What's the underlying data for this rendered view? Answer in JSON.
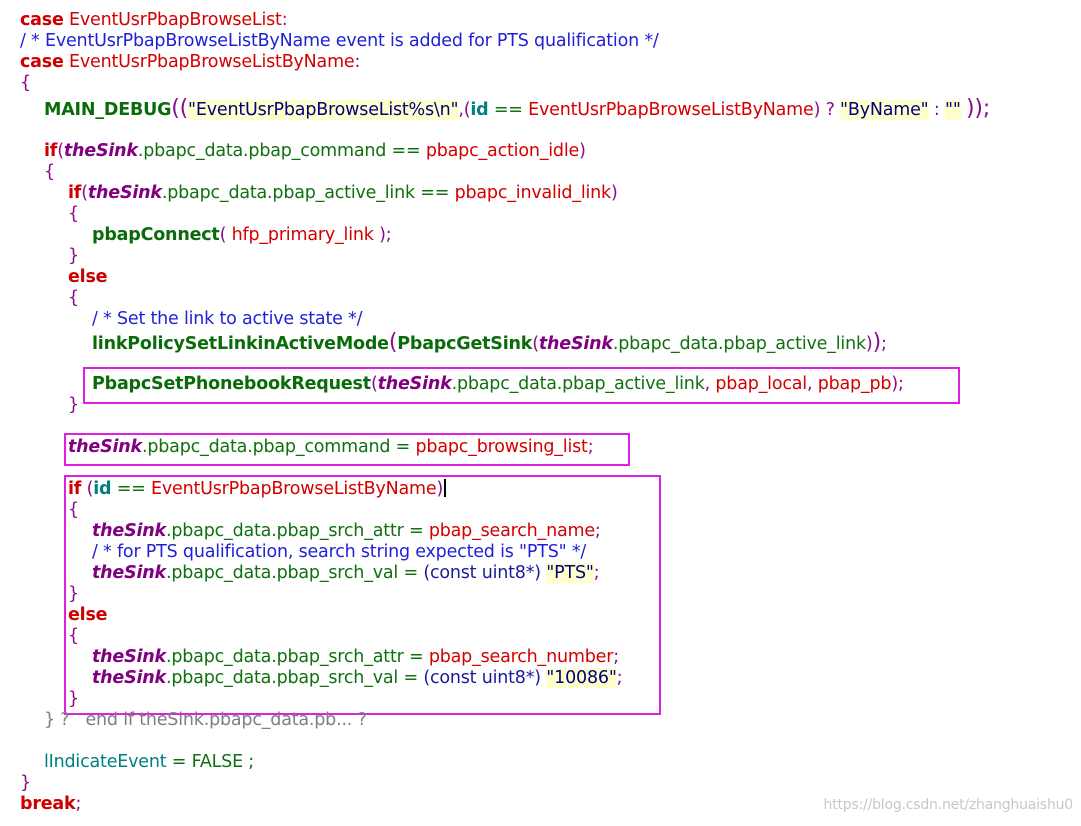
{
  "code": {
    "case1_kw": "case",
    "case1_ev": "EventUsrPbapBrowseList",
    "colon": ":",
    "comment_pts": "/ * EventUsrPbapBrowseListByName event is added for PTS qualification */",
    "case2_kw": "case",
    "case2_ev": "EventUsrPbapBrowseListByName",
    "brace_open": "{",
    "brace_close": "}",
    "main_debug": "MAIN_DEBUG",
    "paren_open_double": "((",
    "paren_close_double": "));",
    "debug_fmt": "\"EventUsrPbapBrowseList%s\\n\"",
    "comma_paren": ",(",
    "id_kw": "id",
    "eqeq": " == ",
    "byname_ev": "EventUsrPbapBrowseListByName",
    "ternary_q": ") ? ",
    "byname_str": "\"ByName\"",
    "ternary_colon": " : ",
    "empty_str": "\"\"",
    "space": " ",
    "if_kw": "if",
    "the_sink": "theSink",
    "pbap_command_member": ".pbapc_data.pbap_command",
    "pbap_active_link_member": ".pbapc_data.pbap_active_link",
    "pbap_srch_attr_member": ".pbapc_data.pbap_srch_attr",
    "pbap_srch_val_member": ".pbapc_data.pbap_srch_val",
    "pbapc_action_idle": "pbapc_action_idle",
    "pbapc_invalid_link": "pbapc_invalid_link",
    "pbap_connect": "pbapConnect",
    "hfp_primary_link": "hfp_primary_link",
    "else_kw": "else",
    "comment_link": "/ * Set the link to active state */",
    "link_policy": "linkPolicySetLinkinActiveMode",
    "pbapc_get_sink": "PbapcGetSink",
    "set_phonebook": "PbapcSetPhonebookRequest",
    "pbap_local": "pbap_local",
    "pbap_pb": "pbap_pb",
    "pbapc_browsing_list": "pbapc_browsing_list",
    "pbap_search_name": "pbap_search_name",
    "comment_search": "/ * for PTS qualification, search string expected is \"PTS\" */",
    "const_cast": "(const uint8*)",
    "pts_str": "\"PTS\"",
    "pbap_search_number": "pbap_search_number",
    "number_str": "\"10086\"",
    "fold_text": "} ?   end if theSink.pbapc_data.pb... ?",
    "indicate_event": "lIndicateEvent",
    "assign_false": " = FALSE ;",
    "break_kw": "break",
    "semicolon": ";"
  },
  "watermark": "https://blog.csdn.net/zhanghuaishu0"
}
